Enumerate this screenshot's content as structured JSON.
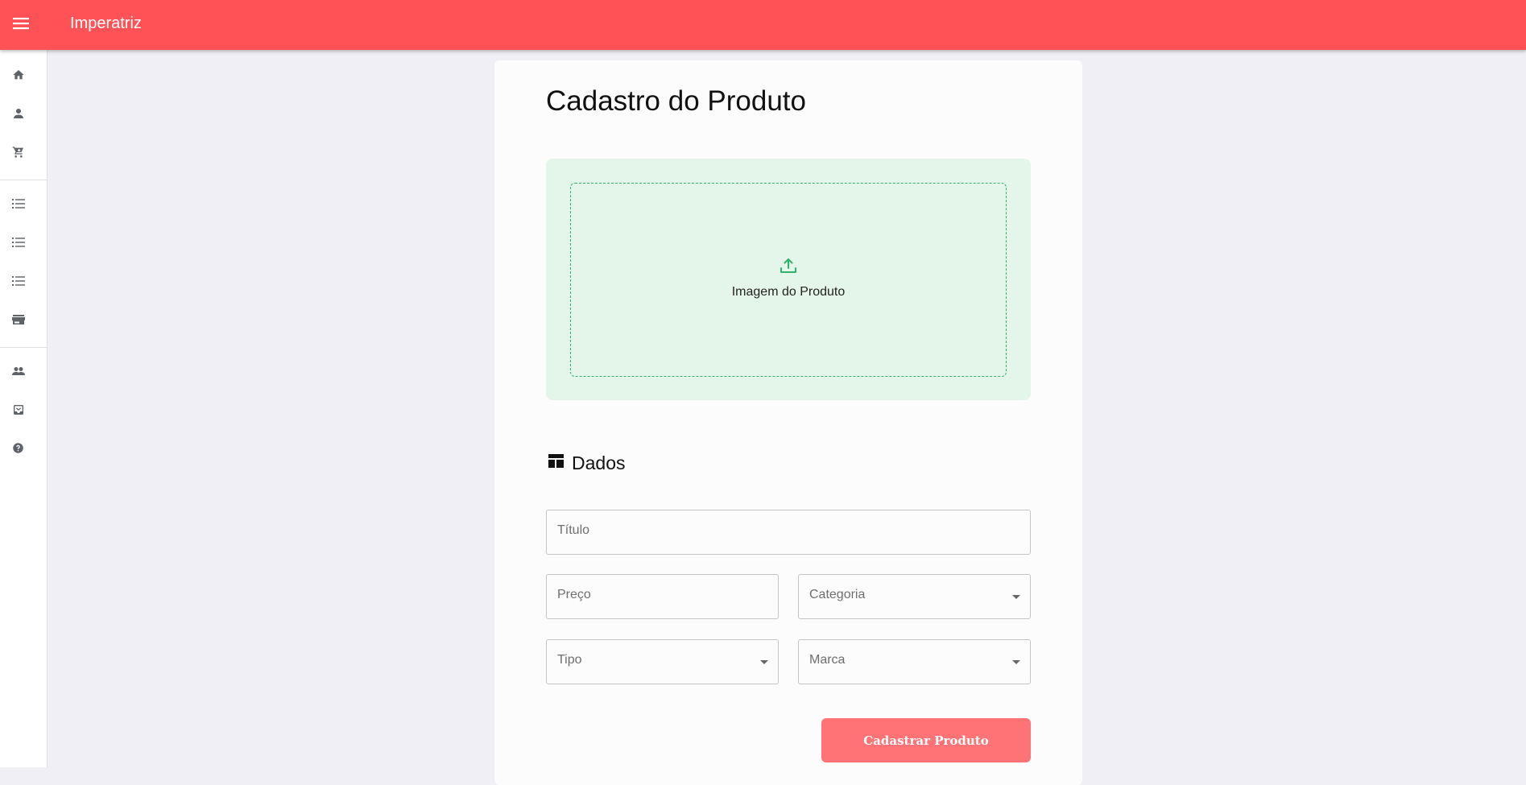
{
  "appbar": {
    "title": "Imperatriz",
    "menu_icon": "menu-icon"
  },
  "sidebar": {
    "items": [
      {
        "icon": "home-icon"
      },
      {
        "icon": "user-icon"
      },
      {
        "icon": "cart-icon"
      },
      {
        "icon": "list-icon"
      },
      {
        "icon": "list-icon"
      },
      {
        "icon": "list-icon"
      },
      {
        "icon": "store-icon"
      },
      {
        "icon": "people-icon"
      },
      {
        "icon": "inbox-icon"
      },
      {
        "icon": "help-icon"
      }
    ]
  },
  "main": {
    "title": "Cadastro do Produto",
    "upload": {
      "label": "Imagem do Produto",
      "icon": "upload-icon"
    },
    "section": {
      "title": "Dados",
      "icon": "dashboard-icon"
    },
    "fields": {
      "titulo": "Título",
      "preco": "Preço",
      "categoria": "Categoria",
      "tipo": "Tipo",
      "marca": "Marca"
    },
    "submit_label": "Cadastrar Produto"
  },
  "colors": {
    "appbar": "#ff5256",
    "button": "#ff7276",
    "upload_bg": "#e4f6e9",
    "upload_accent": "#33b26b",
    "background": "#efeff5"
  }
}
